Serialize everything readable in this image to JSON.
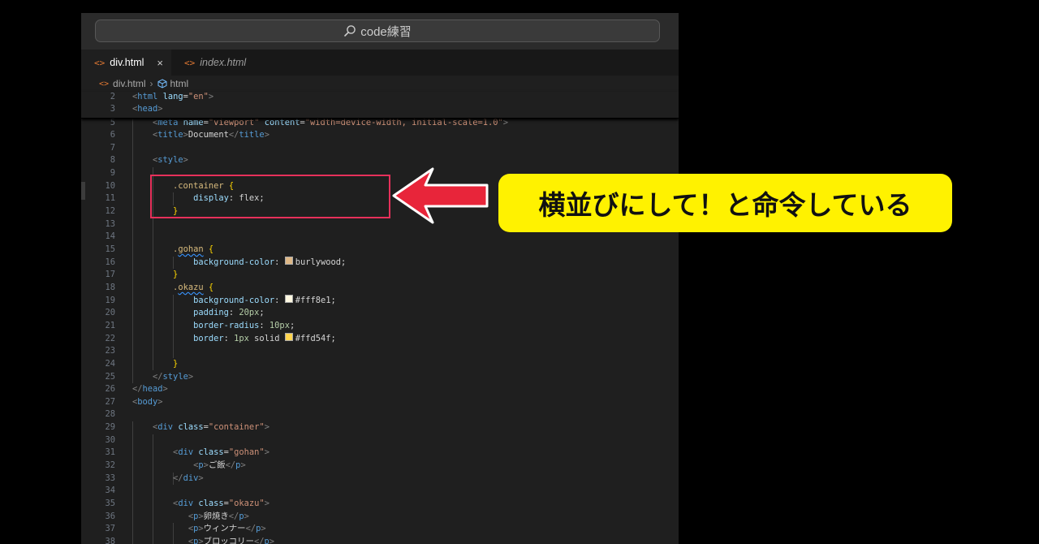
{
  "search": {
    "text": "code練習"
  },
  "tabs": [
    {
      "label": "div.html",
      "close": "×"
    },
    {
      "label": "index.html"
    }
  ],
  "breadcrumb": {
    "file": "div.html",
    "symbol": "html"
  },
  "editor": {
    "lines": [
      {
        "n": "2",
        "html": "<span class='br'>&lt;</span><span class='tg'>html</span> <span class='at'>lang</span><span class='pl'>=</span><span class='st'>\"en\"</span><span class='br'>&gt;</span>"
      },
      {
        "n": "3",
        "html": "<span class='br'>&lt;</span><span class='tg'>head</span><span class='br'>&gt;</span>"
      },
      {
        "n": "5",
        "html": "    <span class='br'>&lt;</span><span class='tg'>meta</span> <span class='at'>name</span>=<span class='st'>\"viewport\"</span> <span class='at'>content</span>=<span class='st'>\"width=device-width, initial-scale=1.0\"</span><span class='br'>&gt;</span>"
      },
      {
        "n": "6",
        "html": "    <span class='br'>&lt;</span><span class='tg'>title</span><span class='br'>&gt;</span>Document<span class='br'>&lt;/</span><span class='tg'>title</span><span class='br'>&gt;</span>"
      },
      {
        "n": "7",
        "html": ""
      },
      {
        "n": "8",
        "html": "    <span class='br'>&lt;</span><span class='tg'>style</span><span class='br'>&gt;</span>"
      },
      {
        "n": "9",
        "html": ""
      },
      {
        "n": "10",
        "html": "        <span class='sel'>.container</span> <span class='bk'>{</span>"
      },
      {
        "n": "11",
        "html": "            <span class='pr'>display</span>: flex;"
      },
      {
        "n": "12",
        "html": "        <span class='bk'>}</span>"
      },
      {
        "n": "13",
        "html": ""
      },
      {
        "n": "14",
        "html": ""
      },
      {
        "n": "15",
        "html": "        <span class='sel'>.<span class='wavy'>gohan</span></span> <span class='bk'>{</span>"
      },
      {
        "n": "16",
        "html": "            <span class='pr'>background-color</span>: <span class='sw' style='background:#deb887'></span>burlywood;"
      },
      {
        "n": "17",
        "html": "        <span class='bk'>}</span>"
      },
      {
        "n": "18",
        "html": "        <span class='sel'>.<span class='wavy'>okazu</span></span> <span class='bk'>{</span>"
      },
      {
        "n": "19",
        "html": "            <span class='pr'>background-color</span>: <span class='sw' style='background:#fff8e1'></span>#fff8e1;"
      },
      {
        "n": "20",
        "html": "            <span class='pr'>padding</span>: <span class='nm'>20px</span>;"
      },
      {
        "n": "21",
        "html": "            <span class='pr'>border-radius</span>: <span class='nm'>10px</span>;"
      },
      {
        "n": "22",
        "html": "            <span class='pr'>border</span>: <span class='nm'>1px</span> solid <span class='sw' style='background:#ffd54f'></span>#ffd54f;"
      },
      {
        "n": "23",
        "html": ""
      },
      {
        "n": "24",
        "html": "        <span class='bk'>}</span>"
      },
      {
        "n": "25",
        "html": "    <span class='br'>&lt;/</span><span class='tg'>style</span><span class='br'>&gt;</span>"
      },
      {
        "n": "26",
        "html": "<span class='br'>&lt;/</span><span class='tg'>head</span><span class='br'>&gt;</span>"
      },
      {
        "n": "27",
        "html": "<span class='br'>&lt;</span><span class='tg'>body</span><span class='br'>&gt;</span>"
      },
      {
        "n": "28",
        "html": ""
      },
      {
        "n": "29",
        "html": "    <span class='br'>&lt;</span><span class='tg'>div</span> <span class='at'>class</span>=<span class='st'>\"container\"</span><span class='br'>&gt;</span>"
      },
      {
        "n": "30",
        "html": ""
      },
      {
        "n": "31",
        "html": "        <span class='br'>&lt;</span><span class='tg'>div</span> <span class='at'>class</span>=<span class='st'>\"gohan\"</span><span class='br'>&gt;</span>"
      },
      {
        "n": "32",
        "html": "            <span class='br'>&lt;</span><span class='tg'>p</span><span class='br'>&gt;</span>ご飯<span class='br'>&lt;/</span><span class='tg'>p</span><span class='br'>&gt;</span>"
      },
      {
        "n": "33",
        "html": "        <span class='br'>&lt;/</span><span class='tg'>div</span><span class='br'>&gt;</span>"
      },
      {
        "n": "34",
        "html": ""
      },
      {
        "n": "35",
        "html": "        <span class='br'>&lt;</span><span class='tg'>div</span> <span class='at'>class</span>=<span class='st'>\"okazu\"</span><span class='br'>&gt;</span>"
      },
      {
        "n": "36",
        "html": "           <span class='br'>&lt;</span><span class='tg'>p</span><span class='br'>&gt;</span>卵焼き<span class='br'>&lt;/</span><span class='tg'>p</span><span class='br'>&gt;</span>"
      },
      {
        "n": "37",
        "html": "           <span class='br'>&lt;</span><span class='tg'>p</span><span class='br'>&gt;</span>ウィンナー<span class='br'>&lt;/</span><span class='tg'>p</span><span class='br'>&gt;</span>"
      },
      {
        "n": "38",
        "html": "           <span class='br'>&lt;</span><span class='tg'>p</span><span class='br'>&gt;</span>ブロッコリー<span class='br'>&lt;/</span><span class='tg'>p</span><span class='br'>&gt;</span>"
      }
    ]
  },
  "callout": {
    "text": "横並びにして！と命令している"
  },
  "colors": {
    "highlight_box": "#e6305a",
    "callout_bg": "#fff200",
    "arrow": "#e8253a"
  }
}
